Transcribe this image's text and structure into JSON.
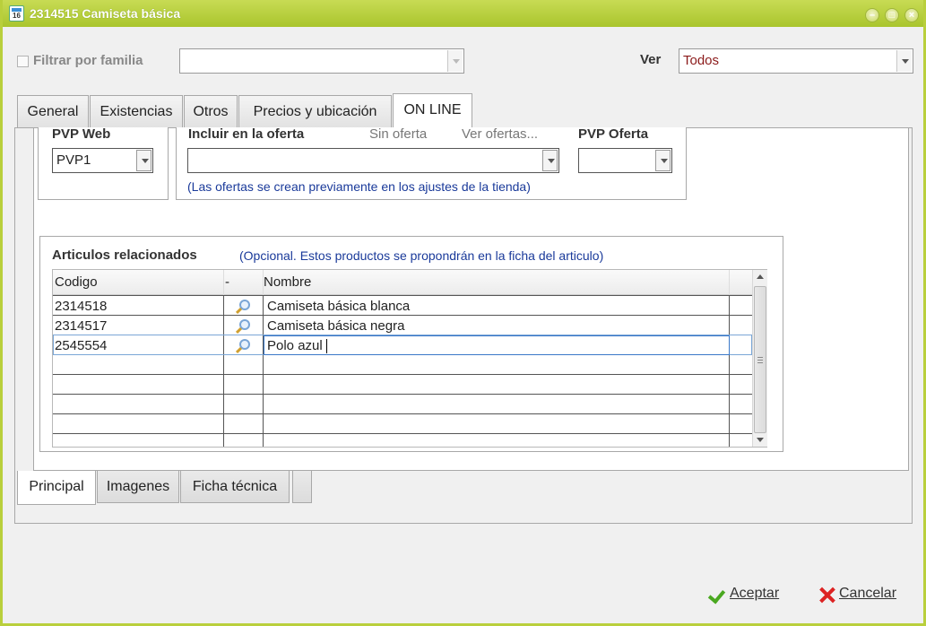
{
  "window": {
    "title": "2314515 Camiseta básica",
    "icon_text": "16"
  },
  "filter": {
    "familia_label": "Filtrar por familia",
    "familia_value": "",
    "ver_label": "Ver",
    "ver_value": "Todos"
  },
  "tabs_top": [
    {
      "label": "General"
    },
    {
      "label": "Existencias"
    },
    {
      "label": "Otros"
    },
    {
      "label": "Precios y ubicación"
    },
    {
      "label": "ON LINE"
    }
  ],
  "online": {
    "pvp_web_label": "PVP Web",
    "pvp_web_value": "PVP1",
    "incluir_label": "Incluir en la oferta",
    "sin_oferta": "Sin oferta",
    "ver_ofertas": "Ver ofertas...",
    "oferta_value": "",
    "pvp_oferta_label": "PVP Oferta",
    "pvp_oferta_value": "",
    "ofertas_note": "(Las ofertas se crean previamente en los ajustes de la tienda)"
  },
  "related": {
    "title": "Articulos relacionados",
    "note": "(Opcional. Estos productos se propondrán en la ficha del articulo)",
    "columns": {
      "codigo": "Codigo",
      "sep": "-",
      "nombre": "Nombre"
    },
    "rows": [
      {
        "codigo": "2314518",
        "nombre": "Camiseta básica blanca"
      },
      {
        "codigo": "2314517",
        "nombre": "Camiseta básica negra"
      },
      {
        "codigo": "2545554",
        "nombre": "Polo azul"
      }
    ]
  },
  "tabs_bottom": [
    {
      "label": "Principal"
    },
    {
      "label": "Imagenes"
    },
    {
      "label": "Ficha técnica"
    }
  ],
  "actions": {
    "accept": "Aceptar",
    "cancel": "Cancelar"
  },
  "colors": {
    "titlebar": "#aac52d",
    "ver_text": "#8b1a1a",
    "note_text": "#1a3a9a",
    "accept_icon": "#4aa820",
    "cancel_icon": "#d22222"
  }
}
